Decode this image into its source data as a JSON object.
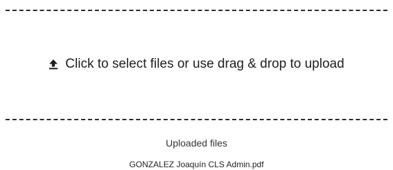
{
  "dropzone": {
    "icon": "upload-icon",
    "label": "Click to select files or use drag & drop to upload"
  },
  "uploaded": {
    "title": "Uploaded files",
    "files": [
      {
        "name": "GONZALEZ Joaquín CLS Admin.pdf"
      }
    ]
  },
  "colors": {
    "border": "#2b2b2b",
    "text": "#222222"
  }
}
